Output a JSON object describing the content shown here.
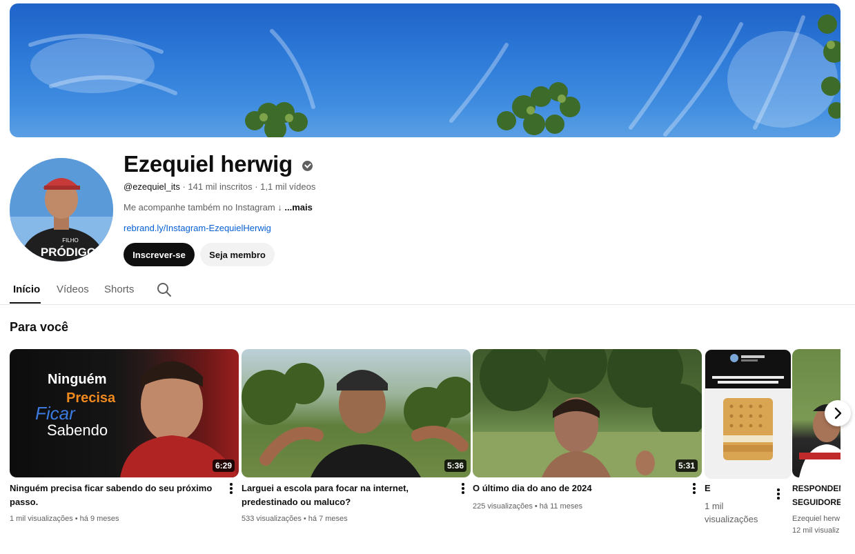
{
  "channel": {
    "name": "Ezequiel herwig",
    "handle": "@ezequiel_its",
    "stats": "· 141 mil inscritos · 1,1 mil vídeos",
    "description": "Me acompanhe também no Instagram ↓",
    "more_label": "...mais",
    "link": "rebrand.ly/Instagram-EzequielHerwig",
    "verified_icon": "verified-check-icon",
    "avatar_shirt_text_top": "FILHO",
    "avatar_shirt_text_bottom": "PRÓDIGO"
  },
  "actions": {
    "subscribe_label": "Inscrever-se",
    "member_label": "Seja membro"
  },
  "tabs": [
    {
      "label": "Início",
      "active": true
    },
    {
      "label": "Vídeos",
      "active": false
    },
    {
      "label": "Shorts",
      "active": false
    }
  ],
  "section": {
    "title": "Para você"
  },
  "videos": [
    {
      "title": "Ninguém precisa ficar sabendo do seu próximo passo.",
      "duration": "6:29",
      "meta": "1 mil visualizações • há 9 meses",
      "thumb_text": [
        "Ninguém",
        "Precisa",
        "Ficar",
        "Sabendo"
      ]
    },
    {
      "title": "Larguei a escola para focar na internet, predestinado ou maluco?",
      "duration": "5:36",
      "meta": "533 visualizações • há 7 meses"
    },
    {
      "title": "O último dia do ano de 2024",
      "duration": "5:31",
      "meta": "225 visualizações • há 11 meses"
    },
    {
      "title": "E",
      "meta_line1": "1 mil",
      "meta_line2": "visualizações"
    },
    {
      "title": "RESPONDEN SEGUIDORE",
      "channel": "Ezequiel herw",
      "meta": "12 mil visualiz"
    }
  ],
  "icons": {
    "search": "search-icon",
    "next": "chevron-right-icon",
    "more": "more-vert-icon"
  },
  "colors": {
    "primary_text": "#0f0f0f",
    "secondary_text": "#606060",
    "link": "#065fd4",
    "subscribe_bg": "#0f0f0f",
    "member_bg": "#f2f2f2"
  }
}
